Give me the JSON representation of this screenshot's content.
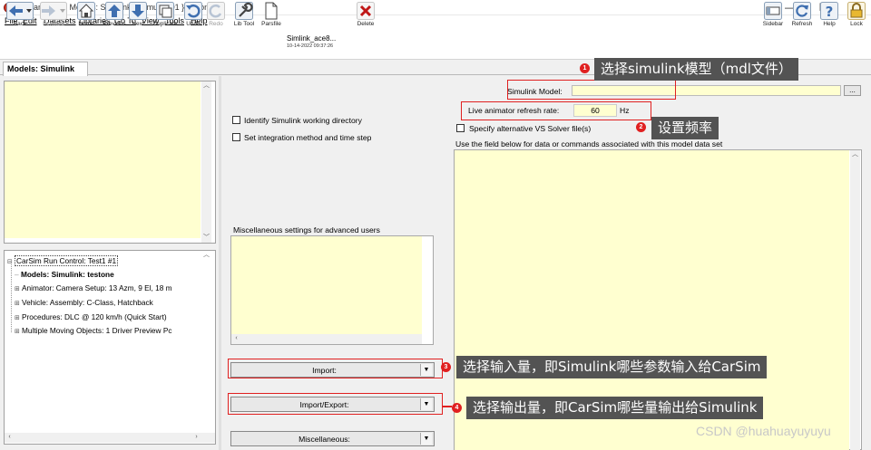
{
  "window": {
    "title": "[1Example01] Models: Simulink; { simulink01 } testone",
    "controls": {
      "minimize": "—",
      "maximize": "☐",
      "close": "✕"
    }
  },
  "menu": [
    "File",
    "Edit",
    "Datasets",
    "Libraries",
    "Go To",
    "View",
    "Tools",
    "Help"
  ],
  "toolbar": {
    "back": "Back",
    "forward": "Forward",
    "home": "Home",
    "previous": "Previous",
    "next": "Next",
    "duplicate": "Duplicate",
    "undo": "Undo",
    "redo": "Redo",
    "lib_tool": "Lib Tool",
    "parsfile": "Parsfile",
    "parsfile_name": "Simlink_ace8...",
    "parsfile_date": "10-14-2022 09:37:26",
    "delete": "Delete",
    "sidebar": "Sidebar",
    "refresh": "Refresh",
    "help": "Help",
    "lock": "Lock"
  },
  "tab": {
    "label": "Models: Simulink"
  },
  "tree": {
    "root": "CarSim Run Control: Test1 #1",
    "selected": "Models: Simulink: testone",
    "items": [
      "Animator: Camera Setup: 13 Azm, 9 El, 18 m",
      "Vehicle: Assembly: C-Class, Hatchback",
      "Procedures: DLC @ 120 km/h (Quick Start)",
      "Multiple Moving Objects: 1 Driver Preview Pc"
    ]
  },
  "form": {
    "identify_wd": "Identify Simulink working directory",
    "set_integration": "Set integration method and time step",
    "misc_label": "Miscellaneous settings for advanced users",
    "simulink_model_label": "Simulink Model:",
    "simulink_model_value": "",
    "browse": "...",
    "rate_label": "Live animator refresh rate:",
    "rate_value": "60",
    "rate_unit": "Hz",
    "alt_solver": "Specify alternative VS Solver file(s)",
    "data_hint": "Use the field below  for data or commands associated with this model data set",
    "import": "Import:",
    "import_export": "Import/Export:",
    "miscellaneous": "Miscellaneous:"
  },
  "annotations": [
    {
      "num": "1",
      "text": "选择simulink模型（mdl文件）"
    },
    {
      "num": "2",
      "text": "设置频率"
    },
    {
      "num": "3",
      "text": "选择输入量，即Simulink哪些参数输入给CarSim"
    },
    {
      "num": "4",
      "text": "选择输出量，即CarSim哪些量输出给Simulink"
    }
  ],
  "watermark": "CSDN @huahuayuyuyu",
  "colors": {
    "note_yellow": "#ffffd0",
    "annotation_red": "#e02020",
    "callout_bg": "#535353"
  },
  "icons": [
    "back-arrow-icon",
    "forward-arrow-icon",
    "home-icon",
    "up-arrow-icon",
    "down-arrow-icon",
    "duplicate-icon",
    "undo-icon",
    "redo-icon",
    "wrench-icon",
    "document-icon",
    "delete-x-icon",
    "sidebar-icon",
    "refresh-icon",
    "help-icon",
    "lock-icon"
  ]
}
